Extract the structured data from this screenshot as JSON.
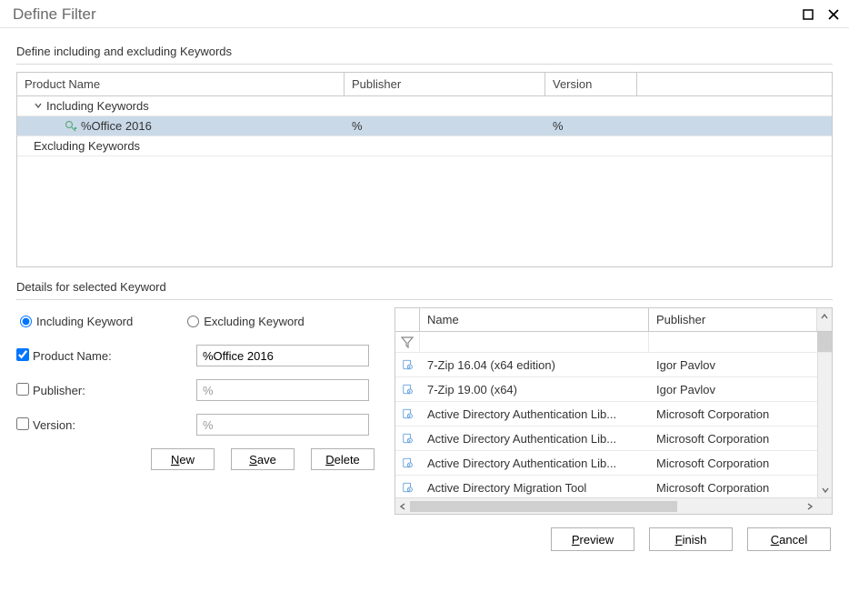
{
  "window": {
    "title": "Define Filter"
  },
  "sections": {
    "top_label": "Define including and excluding Keywords",
    "details_label": "Details for selected Keyword"
  },
  "top_grid": {
    "columns": {
      "product_name": "Product Name",
      "publisher": "Publisher",
      "version": "Version"
    },
    "rows": {
      "including_group": "Including Keywords",
      "item": {
        "name": "%Office 2016",
        "publisher": "%",
        "version": "%"
      },
      "excluding_group": "Excluding Keywords"
    }
  },
  "details": {
    "radio_including": "Including Keyword",
    "radio_excluding": "Excluding Keyword",
    "product_name_label": "Product Name:",
    "product_name_value": "%Office 2016",
    "publisher_label": "Publisher:",
    "publisher_value": "%",
    "version_label": "Version:",
    "version_value": "%",
    "checks": {
      "pn": true,
      "pub": false,
      "ver": false
    }
  },
  "buttons": {
    "new_pre": "",
    "new_u": "N",
    "new_post": "ew",
    "save_pre": "",
    "save_u": "S",
    "save_post": "ave",
    "delete_pre": "",
    "delete_u": "D",
    "delete_post": "elete",
    "preview_pre": "",
    "preview_u": "P",
    "preview_post": "review",
    "finish_pre": "",
    "finish_u": "F",
    "finish_post": "inish",
    "cancel_pre": "",
    "cancel_u": "C",
    "cancel_post": "ancel"
  },
  "results": {
    "columns": {
      "name": "Name",
      "publisher": "Publisher"
    },
    "rows": [
      {
        "name": "7-Zip 16.04 (x64 edition)",
        "publisher": "Igor Pavlov"
      },
      {
        "name": "7-Zip 19.00 (x64)",
        "publisher": "Igor Pavlov"
      },
      {
        "name": "Active Directory Authentication Lib...",
        "publisher": "Microsoft Corporation"
      },
      {
        "name": "Active Directory Authentication Lib...",
        "publisher": "Microsoft Corporation"
      },
      {
        "name": "Active Directory Authentication Lib...",
        "publisher": "Microsoft Corporation"
      },
      {
        "name": "Active Directory Migration Tool",
        "publisher": "Microsoft Corporation"
      }
    ]
  }
}
